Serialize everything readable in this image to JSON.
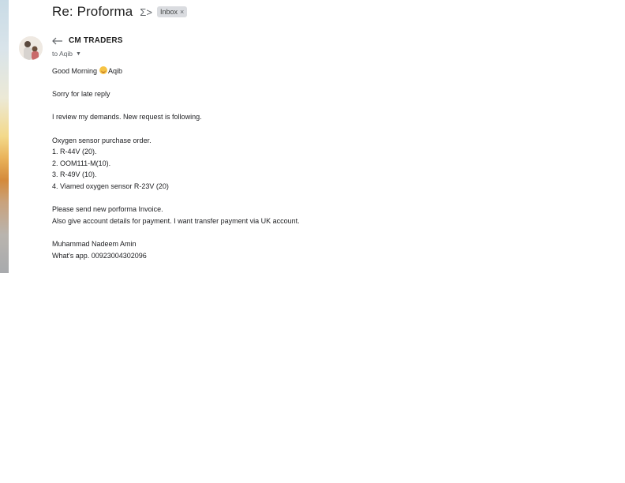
{
  "email": {
    "subject": "Re: Proforma",
    "importance_icon": "Σ>",
    "label": "Inbox",
    "label_remove": "×",
    "sender": "CM TRADERS",
    "to_line": "to Aqib",
    "to_dropdown": "▼",
    "body": {
      "greeting_prefix": "Good Morning",
      "greeting_name": "Aqib",
      "line_sorry": "Sorry for late reply",
      "line_review": "I review my demands. New request is following.",
      "order_heading": "Oxygen sensor purchase order.",
      "order_items": [
        "1. R-44V (20).",
        "2. OOM111-M(10).",
        "3. R-49V (10).",
        "4. Viamed oxygen sensor R-23V (20)"
      ],
      "line_invoice": "Please send new porforma Invoice.",
      "line_account": "Also give account details for payment. I want transfer payment via UK account.",
      "signature_name": "Muhammad Nadeem Amin",
      "signature_whatsapp": "What's app. 00923004302096"
    }
  },
  "icons": {
    "reply": "reply-arrow",
    "importance": "importance-marker",
    "emoji": "smiling-face"
  },
  "colors": {
    "label_chip_bg": "#dadce0",
    "text_primary": "#202124",
    "text_secondary": "#5f6368"
  }
}
